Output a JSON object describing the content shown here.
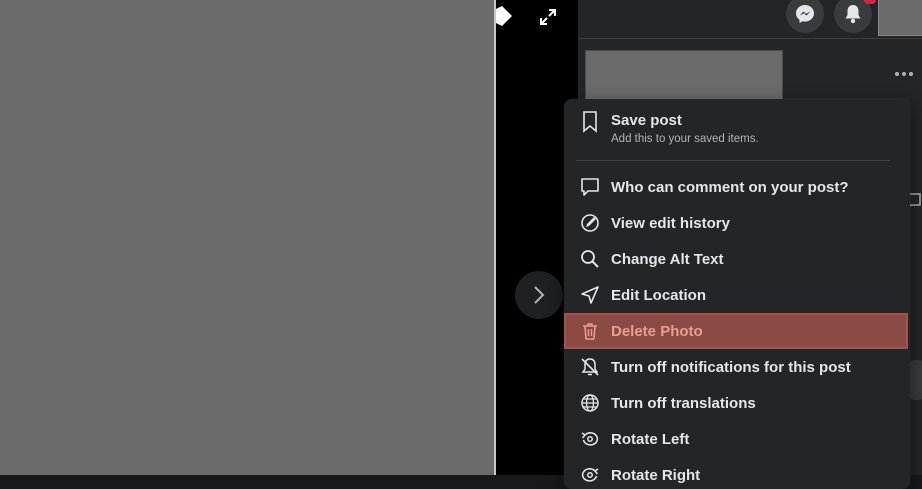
{
  "menu": {
    "save_post": {
      "label": "Save post",
      "sublabel": "Add this to your saved items."
    },
    "items": [
      {
        "label": "Who can comment on your post?"
      },
      {
        "label": "View edit history"
      },
      {
        "label": "Change Alt Text"
      },
      {
        "label": "Edit Location"
      },
      {
        "label": "Delete Photo"
      },
      {
        "label": "Turn off notifications for this post"
      },
      {
        "label": "Turn off translations"
      },
      {
        "label": "Rotate Left"
      },
      {
        "label": "Rotate Right"
      }
    ]
  },
  "colors": {
    "background": "#18191a",
    "panel": "#242526",
    "text_primary": "#e4e6eb",
    "text_secondary": "#b0b3b8",
    "danger_highlight": "#8b4a43",
    "danger_text": "#ed9c93",
    "notification_badge": "#e41e3f",
    "redacted": "#6b6b6b"
  },
  "icons": {
    "save_post": "bookmark-icon",
    "who_can_comment": "comment-icon",
    "view_edit_history": "edit-history-icon",
    "change_alt_text": "search-icon",
    "edit_location": "location-arrow-icon",
    "delete_photo": "trash-icon",
    "turn_off_notifications": "bell-off-icon",
    "turn_off_translations": "globe-icon",
    "rotate_left": "rotate-left-icon",
    "rotate_right": "rotate-right-icon"
  }
}
